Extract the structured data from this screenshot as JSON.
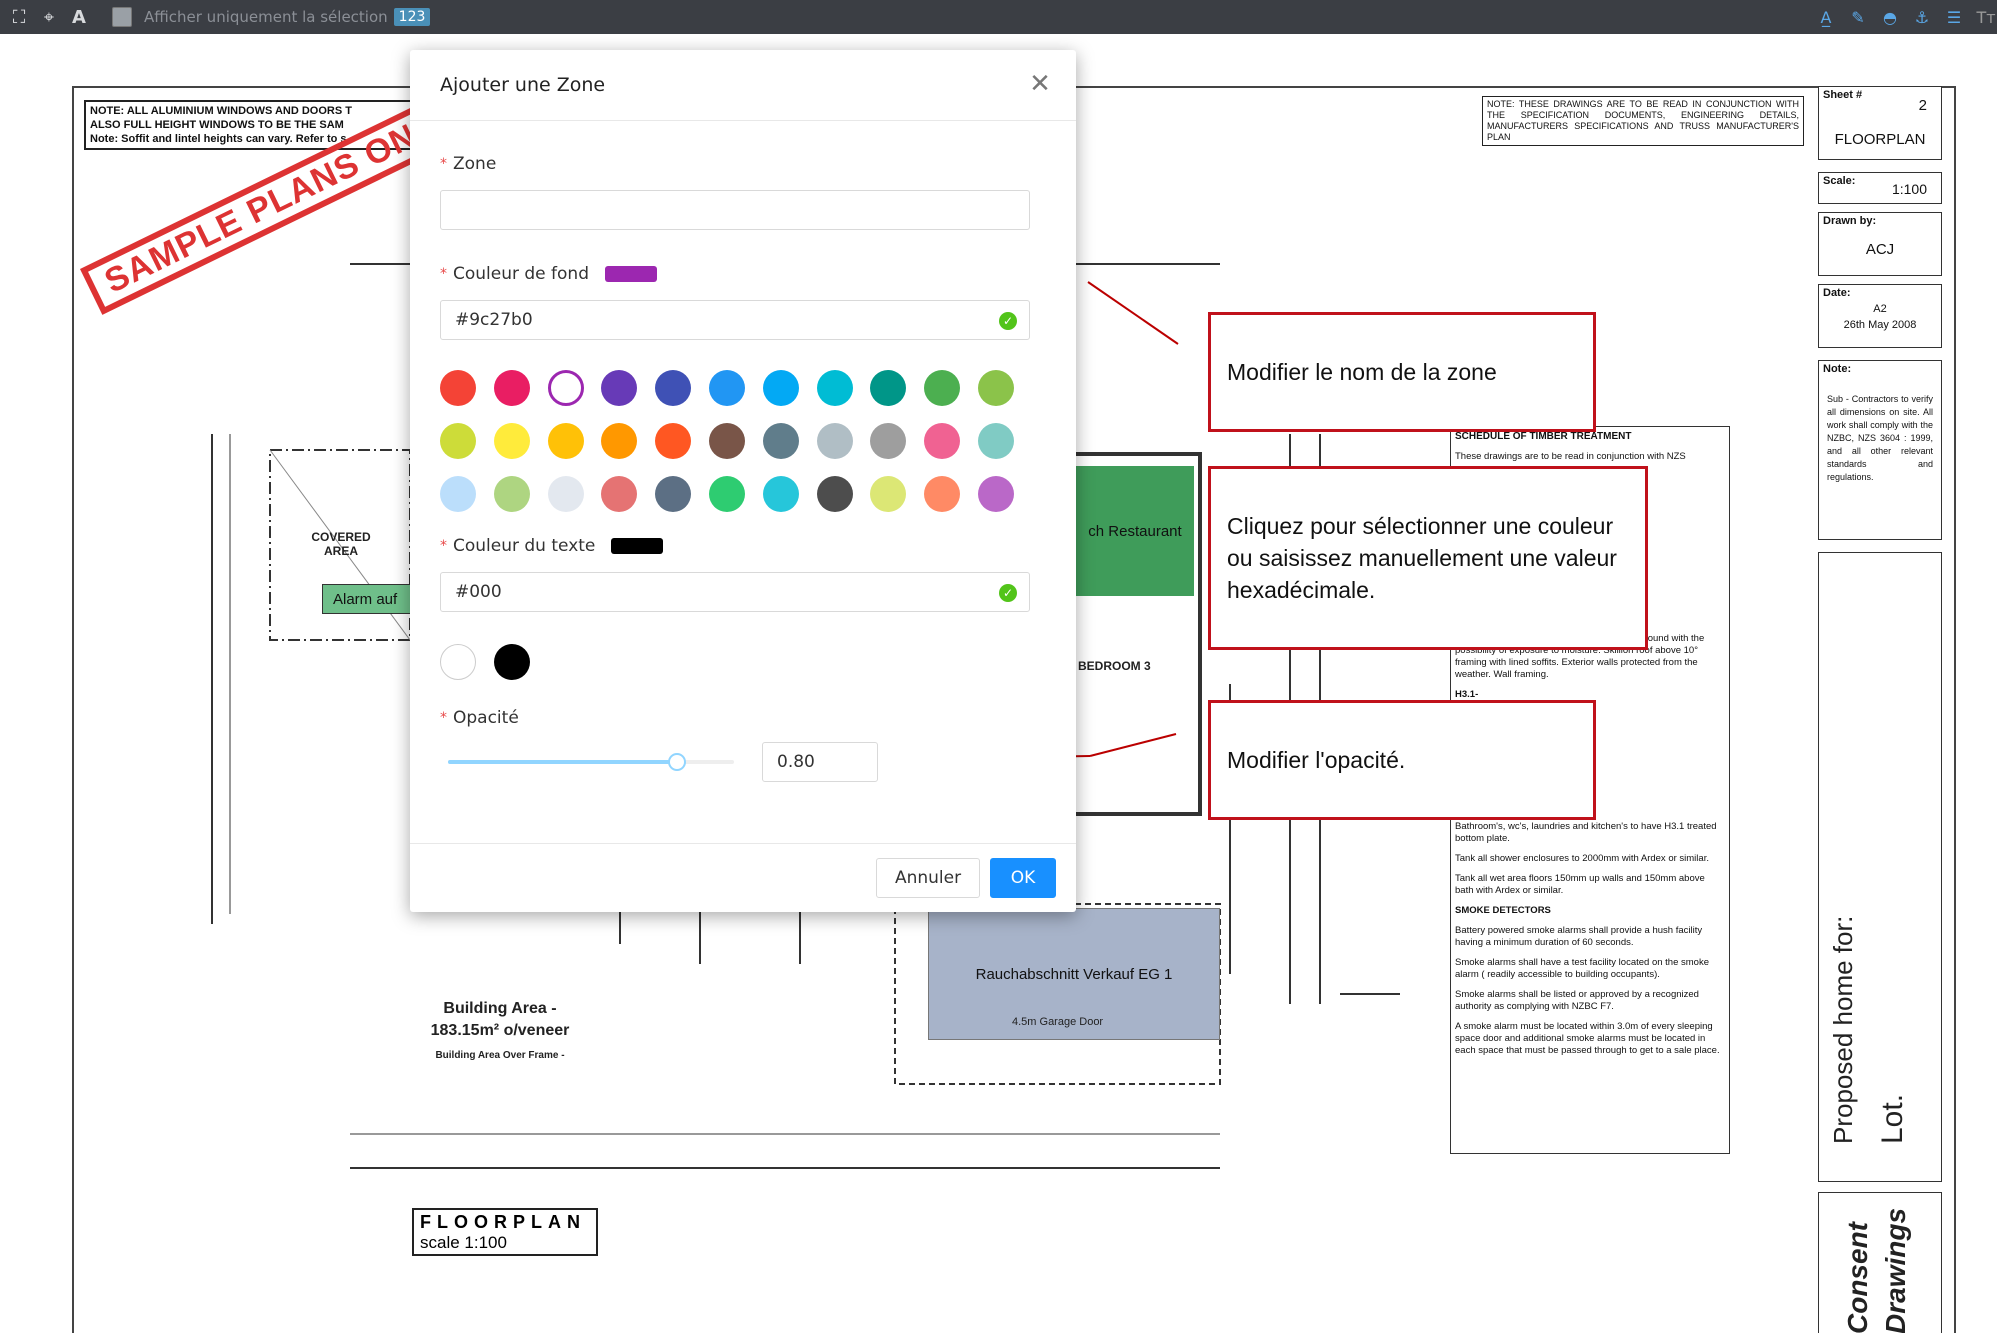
{
  "toolbar": {
    "filter_label": "Afficher uniquement la sélection",
    "badge": "123"
  },
  "plan": {
    "note_left": [
      "NOTE: ALL ALUMINIUM WINDOWS AND DOORS T",
      "ALSO FULL HEIGHT WINDOWS TO BE THE SAM",
      "Note: Soffit and lintel heights can vary. Refer to s"
    ],
    "stamp": "SAMPLE PLANS ONLY",
    "note_right": "NOTE: THESE DRAWINGS ARE TO BE READ IN CONJUNCTION WITH THE SPECIFICATION DOCUMENTS, ENGINEERING DETAILS, MANUFACTURERS SPECIFICATIONS AND TRUSS MANUFACTURER'S PLAN",
    "covered_area": "COVERED AREA",
    "alarm_zone": "Alarm auf",
    "restaurant_zone": "ch Restaurant",
    "bedroom": "BEDROOM 3",
    "smoke_zone": "Rauchabschnitt Verkauf EG 1",
    "garage_door": "4.5m Garage Door",
    "building_area_1": "Building Area -",
    "building_area_2": "183.15m² o/veneer",
    "building_area_3": "Building Area Over Frame -",
    "title_1": "FLOORPLAN",
    "title_2": "scale 1:100",
    "sheet_label": "Sheet #",
    "sheet_value": "2",
    "sheet_title": "FLOORPLAN",
    "scale_label": "Scale:",
    "scale_value": "1:100",
    "drawn_label": "Drawn by:",
    "drawn_value": "ACJ",
    "date_label": "Date:",
    "date_value_1": "A2",
    "date_value_2": "26th May 2008",
    "note_label": "Note:",
    "note_body": "Sub - Contractors to verify all dimensions on site. All work shall comply with the NZBC, NZS 3604 : 1999, and all other relevant standards and regulations.",
    "schedule_title": "SCHEDULE OF TIMBER TREATMENT",
    "schedule_lines": [
      "These drawings are to be read in conjunction with NZS",
      "Framing protected from the weather, above ground with the possibility of exposure to moisture. Skillion roof above 10° framing with lined soffits. Exterior walls protected from the weather. Wall framing.",
      "H3.1-",
      "Bathroom's, wc's, laundries and kitchen's to have H3.1 treated bottom plate.",
      "Tank all shower enclosures to 2000mm with Ardex or similar.",
      "Tank all wet area floors 150mm up walls and 150mm above bath with Ardex or similar.",
      "SMOKE DETECTORS",
      "Battery powered smoke alarms shall provide a hush facility having a minimum duration of 60 seconds.",
      "Smoke alarms shall have a test facility located on the smoke alarm ( readily accessible to building occupants).",
      "Smoke alarms shall be listed or approved by a recognized authority as complying with NZBC F7.",
      "A smoke alarm must be located within 3.0m of every sleeping space door and additional smoke alarms must be located in each space that must be passed through to get to a sale place."
    ],
    "proposed": "Proposed home for:",
    "lot": "Lot.",
    "consent_1": "Consent",
    "consent_2": "Drawings"
  },
  "modal": {
    "title": "Ajouter une Zone",
    "zone_label": "Zone",
    "zone_value": "",
    "bg_label": "Couleur de fond",
    "bg_value": "#9c27b0",
    "bg_color": "#9c27b0",
    "text_label": "Couleur du texte",
    "text_value": "#000",
    "text_color": "#000000",
    "opacity_label": "Opacité",
    "opacity_value": "0.80",
    "opacity": 0.8,
    "cancel_label": "Annuler",
    "ok_label": "OK",
    "palette": [
      [
        "#f44336",
        "#e91e63",
        "#9c27b0",
        "#673ab7",
        "#3f51b5",
        "#2196f3",
        "#03a9f4",
        "#00bcd4",
        "#009688",
        "#4caf50",
        "#8bc34a"
      ],
      [
        "#cddc39",
        "#ffeb3b",
        "#ffc107",
        "#ff9800",
        "#ff5722",
        "#795548",
        "#607d8b",
        "#b0bec5",
        "#9e9e9e",
        "#f06292",
        "#80cbc4"
      ],
      [
        "#bbdefb",
        "#aed581",
        "#e3e8ef",
        "#e57373",
        "#5c6f84",
        "#2ecc71",
        "#26c6da",
        "#4d4d4d",
        "#dce775",
        "#ff8a65",
        "#ba68c8"
      ]
    ],
    "selected_bg": "#9c27b0",
    "text_palette": [
      "#ffffff",
      "#000000"
    ]
  },
  "callouts": {
    "zone_name": "Modifier le nom de la zone",
    "color": "Cliquez pour sélectionner une couleur ou saisissez manuellement une valeur hexadécimale.",
    "opacity": "Modifier l'opacité."
  }
}
